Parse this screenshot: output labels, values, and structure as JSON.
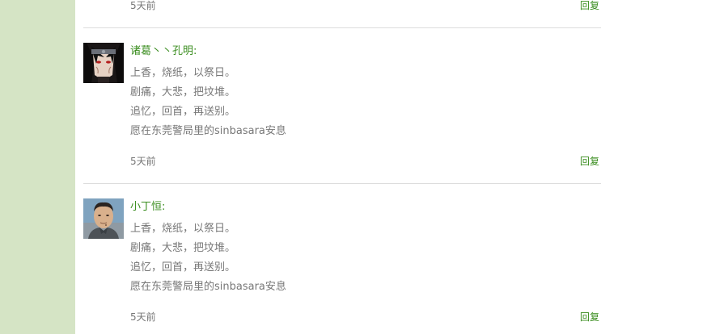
{
  "colors": {
    "sidebar": "#d5e4c5",
    "accent_green": "#3a8d1f",
    "text_gray": "#777777",
    "divider": "#dddddd"
  },
  "top": {
    "time": "5天前",
    "reply_label": "回复"
  },
  "comments": [
    {
      "author": "诸葛丶丶孔明:",
      "lines": [
        "上香，烧纸，以祭日。",
        "剧痛，大悲，把坟堆。",
        "追忆，回首，再送别。",
        "愿在东莞警局里的sinbasara安息"
      ],
      "time": "5天前",
      "reply_label": "回复",
      "avatar_icon": "anime-character-avatar-icon"
    },
    {
      "author": "小丁恒:",
      "lines": [
        "上香，烧纸，以祭日。",
        "剧痛，大悲，把坟堆。",
        "追忆，回首，再送别。",
        "愿在东莞警局里的sinbasara安息"
      ],
      "time": "5天前",
      "reply_label": "回复",
      "avatar_icon": "portrait-photo-avatar-icon"
    }
  ]
}
